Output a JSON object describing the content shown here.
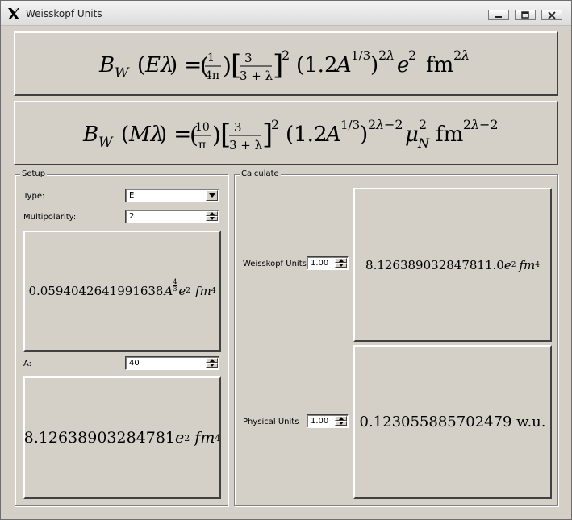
{
  "window": {
    "title": "Weisskopf Units",
    "app_icon": "x-logo-icon"
  },
  "formulas": {
    "electric": "B_W (Eλ) = (1/4π)[3/(3+λ)]² (1.2A^{1/3})^{2λ} e² fm^{2λ}",
    "magnetic": "B_W (Mλ) = (10/π)[3/(3+λ)]² (1.2A^{1/3})^{2λ−2} μ_N² fm^{2λ−2}"
  },
  "setup": {
    "title": "Setup",
    "type_label": "Type:",
    "type_value": "E",
    "multipolarity_label": "Multipolarity:",
    "multipolarity_value": "2",
    "coef_result": {
      "mantissa": "0.0594042641991638",
      "a_exp_num": "4",
      "a_exp_den": "3"
    },
    "a_label": "A:",
    "a_value": "40",
    "value_result": {
      "mantissa": "8.12638903284781"
    }
  },
  "calculate": {
    "title": "Calculate",
    "weisskopf_label": "Weisskopf Units",
    "weisskopf_value": "1.00",
    "weisskopf_result": {
      "mantissa": "8.126389032847811.0"
    },
    "physical_label": "Physical Units",
    "physical_value": "1.00",
    "physical_result": {
      "text": "0.123055885702479 w.u."
    }
  }
}
